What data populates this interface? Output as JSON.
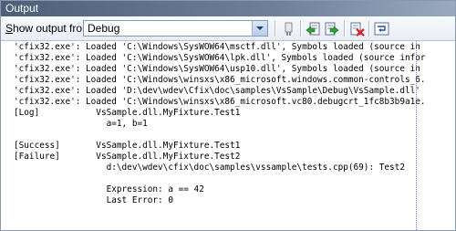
{
  "title": "Output",
  "toolbar": {
    "show_label_prefix": "S",
    "show_label_rest": "how output from:",
    "source_value": "Debug",
    "buttons": [
      "find-message-icon",
      "prev-message-icon",
      "next-message-icon",
      "clear-all-icon",
      "toggle-word-wrap-icon"
    ]
  },
  "output_lines": [
    "'cfix32.exe': Loaded 'C:\\Windows\\SysWOW64\\msctf.dll', Symbols loaded (source in",
    "'cfix32.exe': Loaded 'C:\\Windows\\SysWOW64\\lpk.dll', Symbols loaded (source infor",
    "'cfix32.exe': Loaded 'C:\\Windows\\SysWOW64\\usp10.dll', Symbols loaded (source in",
    "'cfix32.exe': Loaded 'C:\\Windows\\winsxs\\x86_microsoft.windows.common-controls_6.",
    "'cfix32.exe': Loaded 'D:\\dev\\wdev\\Cfix\\doc\\samples\\VsSample\\Debug\\VsSample.dll'",
    "'cfix32.exe': Loaded 'C:\\Windows\\winsxs\\x86_microsoft.vc80.debugcrt_1fc8b3b9a1e.",
    "[Log]           VsSample.dll.MyFixture.Test1",
    "                  a=1, b=1",
    "",
    "[Success]       VsSample.dll.MyFixture.Test1",
    "[Failure]       VsSample.dll.MyFixture.Test2",
    "                  d:\\dev\\wdev\\cfix\\doc\\samples\\vssample\\tests.cpp(69): Test2",
    "",
    "                  Expression: a == 42",
    "                  Last Error: 0"
  ]
}
